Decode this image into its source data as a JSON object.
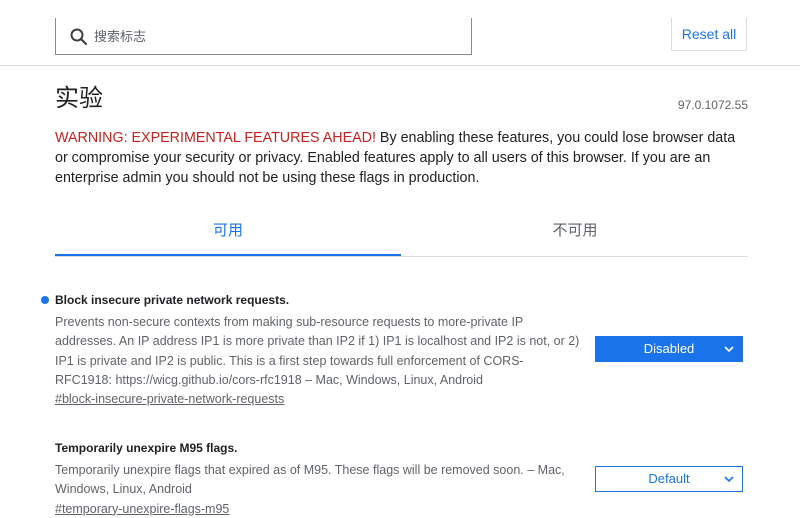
{
  "header": {
    "search_placeholder": "搜索标志",
    "search_value": "",
    "reset_label": "Reset all"
  },
  "page": {
    "title": "实验",
    "version": "97.0.1072.55",
    "warning_prefix": "WARNING: EXPERIMENTAL FEATURES AHEAD!",
    "warning_text": " By enabling these features, you could lose browser data or compromise your security or privacy. Enabled features apply to all users of this browser. If you are an enterprise admin you should not be using these flags in production."
  },
  "tabs": [
    {
      "label": "可用",
      "active": true
    },
    {
      "label": "不可用",
      "active": false
    }
  ],
  "flags": [
    {
      "name": "Block insecure private network requests.",
      "description": "Prevents non-secure contexts from making sub-resource requests to more-private IP addresses. An IP address IP1 is more private than IP2 if 1) IP1 is localhost and IP2 is not, or 2) IP1 is private and IP2 is public. This is a first step towards full enforcement of CORS-RFC1918: https://wicg.github.io/cors-rfc1918 – Mac, Windows, Linux, Android",
      "link": "#block-insecure-private-network-requests",
      "select_value": "Disabled"
    },
    {
      "name": "Temporarily unexpire M95 flags.",
      "description": "Temporarily unexpire flags that expired as of M95. These flags will be removed soon. – Mac, Windows, Linux, Android",
      "link": "#temporary-unexpire-flags-m95",
      "select_value": "Default"
    }
  ],
  "colors": {
    "accent": "#1a73e8",
    "warning_red": "#c5221f",
    "modified_dot": "#1a73e8"
  },
  "icons": {
    "search": "search-icon",
    "chevron": "chevron-down-icon",
    "modified_indicator": "modified-dot-icon"
  }
}
